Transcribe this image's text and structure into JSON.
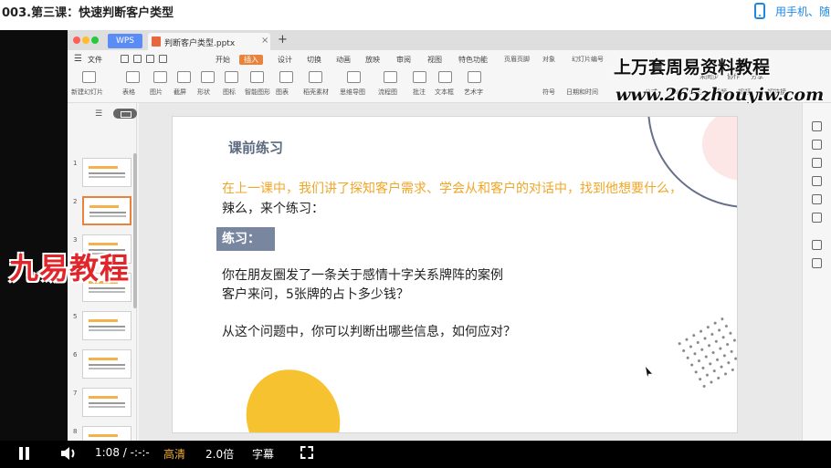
{
  "header": {
    "title": "003.第三课：快速判断客户类型",
    "phone_link": "用手机、随"
  },
  "wps": {
    "app_tab": "WPS",
    "file_tab": "判断客户类型.pptx",
    "menu_file": "文件",
    "menu_tabs": [
      "开始",
      "插入",
      "设计",
      "切换",
      "动画",
      "放映",
      "审阅",
      "视图",
      "特色功能"
    ],
    "active_tab": "插入",
    "tools": [
      "新建幻灯片",
      "表格",
      "图片",
      "截屏",
      "形状",
      "图标",
      "智能图形",
      "图表",
      "稻壳素材",
      "思维导图",
      "流程图",
      "批注",
      "文本框",
      "艺术字",
      "页眉页脚",
      "对象",
      "幻灯片编号"
    ],
    "tools_row2": [
      "日期和时间",
      "公式",
      "LaTeX公式",
      "音频",
      "视频",
      "超链接"
    ],
    "tools_top": [
      "页眉页脚",
      "对象",
      "幻灯片编号"
    ],
    "tools_mid": [
      "日期和时间",
      "符号"
    ],
    "share": [
      "未同步",
      "协作",
      "分享"
    ]
  },
  "watermarks": {
    "title": "上万套周易资料教程",
    "url": "www.265zhouyiw.com",
    "left": "九易教程"
  },
  "thumbnails": [
    "1",
    "2",
    "3",
    "4",
    "5",
    "6",
    "7",
    "8"
  ],
  "slide": {
    "heading": "课前练习",
    "intro_orange": "在上一课中，我们讲了探知客户需求、学会从和客户的对话中，找到他想要什么，",
    "intro_dark": "辣么，来个练习：",
    "exercise_label": "练习：",
    "q1": "你在朋友圈发了一条关于感情十字关系牌阵的案例",
    "q2": "客户来问，5张牌的占卜多少钱？",
    "q3": "从这个问题中，你可以判断出哪些信息，如何应对？"
  },
  "player": {
    "time": "1:08 / -:-:-",
    "quality": "高清",
    "speed": "2.0倍",
    "subtitle": "字幕"
  }
}
